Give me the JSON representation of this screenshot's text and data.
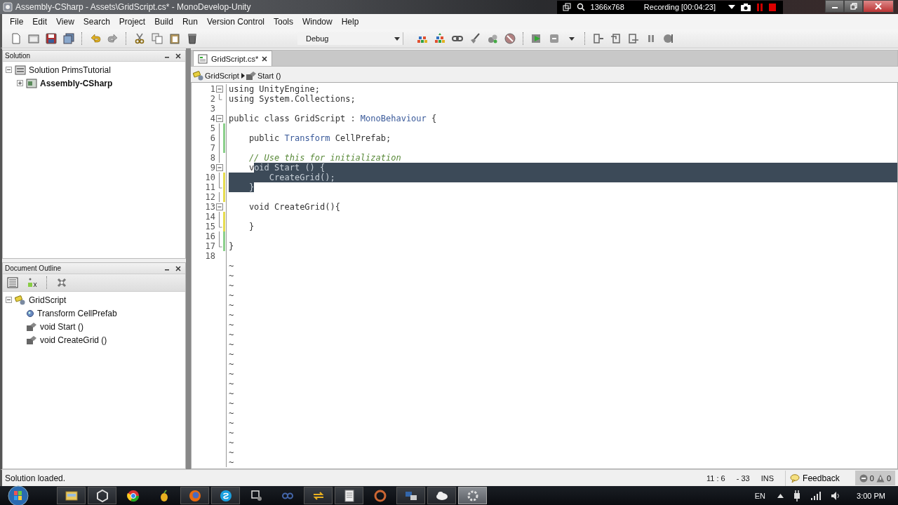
{
  "window": {
    "title": "Assembly-CSharp - Assets\\GridScript.cs* - MonoDevelop-Unity"
  },
  "recorder": {
    "resolution": "1366x768",
    "status": "Recording [00:04:23]"
  },
  "menu": [
    "File",
    "Edit",
    "View",
    "Search",
    "Project",
    "Build",
    "Run",
    "Version Control",
    "Tools",
    "Window",
    "Help"
  ],
  "toolbar": {
    "configuration": "Debug"
  },
  "solution_pane": {
    "title": "Solution",
    "tree": [
      {
        "label": "Solution PrimsTutorial",
        "kind": "solution",
        "expanded": true,
        "children": [
          {
            "label": "Assembly-CSharp",
            "kind": "project",
            "expanded": false
          }
        ]
      }
    ]
  },
  "outline_pane": {
    "title": "Document Outline",
    "tree": [
      {
        "label": "GridScript",
        "kind": "class",
        "expanded": true,
        "children": [
          {
            "label": "Transform CellPrefab",
            "kind": "field"
          },
          {
            "label": "void Start ()",
            "kind": "method"
          },
          {
            "label": "void CreateGrid ()",
            "kind": "method"
          }
        ]
      }
    ]
  },
  "editor": {
    "tabs": [
      {
        "label": "GridScript.cs*",
        "selected": true
      }
    ],
    "breadcrumb": [
      "GridScript",
      "Start ()"
    ],
    "lines": [
      {
        "number": "1",
        "fold_start": true,
        "tokens": [
          {
            "text": "using",
            "kind": "kw"
          },
          {
            "text": " UnityEngine;",
            "kind": "plain"
          }
        ]
      },
      {
        "number": "2",
        "fold_end": true,
        "tokens": [
          {
            "text": "using",
            "kind": "kw"
          },
          {
            "text": " System.Collections;",
            "kind": "plain"
          }
        ]
      },
      {
        "number": "3"
      },
      {
        "number": "4",
        "fold_start": true,
        "tokens": [
          {
            "text": "public class",
            "kind": "kw"
          },
          {
            "text": " GridScript : ",
            "kind": "plain"
          },
          {
            "text": "MonoBehaviour",
            "kind": "type"
          },
          {
            "text": " {",
            "kind": "plain"
          }
        ]
      },
      {
        "number": "5",
        "in_fold": true,
        "changed": true,
        "saved": true
      },
      {
        "number": "6",
        "in_fold": true,
        "changed": true,
        "saved": true,
        "tokens": [
          {
            "text": "    public ",
            "kind": "kw"
          },
          {
            "text": "Transform",
            "kind": "type"
          },
          {
            "text": " CellPrefab;",
            "kind": "plain"
          }
        ]
      },
      {
        "number": "7",
        "in_fold": true,
        "changed": true,
        "saved": true
      },
      {
        "number": "8",
        "in_fold": true,
        "tokens": [
          {
            "text": "    // Use this for initialization",
            "kind": "comment"
          }
        ]
      },
      {
        "number": "9",
        "fold_start": true,
        "selection_extends": true,
        "tokens": [
          {
            "text": "    v",
            "kind": "kw"
          },
          {
            "text": "oid",
            "kind": "kw",
            "selected": true
          },
          {
            "text": " Start () {",
            "kind": "plain",
            "selected": true
          }
        ]
      },
      {
        "number": "10",
        "in_fold": true,
        "changed": true,
        "saved": false,
        "selection_extends": true,
        "tokens": [
          {
            "text": "        CreateGrid();",
            "kind": "plain",
            "selected": true
          }
        ]
      },
      {
        "number": "11",
        "fold_end": true,
        "changed": true,
        "saved": false,
        "tokens": [
          {
            "text": "    }",
            "kind": "plain",
            "selected": true
          }
        ]
      },
      {
        "number": "12",
        "in_fold": true,
        "changed": true,
        "saved": false
      },
      {
        "number": "13",
        "fold_start": true,
        "tokens": [
          {
            "text": "    void",
            "kind": "kw"
          },
          {
            "text": " CreateGrid(){",
            "kind": "plain"
          }
        ]
      },
      {
        "number": "14",
        "in_fold": true,
        "changed": true,
        "saved": false
      },
      {
        "number": "15",
        "fold_end": true,
        "changed": true,
        "saved": false,
        "tokens": [
          {
            "text": "    }",
            "kind": "plain"
          }
        ]
      },
      {
        "number": "16",
        "in_fold": true,
        "changed": true,
        "saved": true
      },
      {
        "number": "17",
        "fold_end": true,
        "changed": true,
        "saved": true,
        "tokens": [
          {
            "text": "}",
            "kind": "plain"
          }
        ]
      },
      {
        "number": "18"
      }
    ],
    "empty_line_markers": [
      "~",
      "~",
      "~",
      "~",
      "~",
      "~",
      "~",
      "~",
      "~",
      "~",
      "~",
      "~",
      "~",
      "~",
      "~",
      "~",
      "~",
      "~",
      "~",
      "~",
      "~"
    ]
  },
  "status_bar": {
    "message": "Solution loaded.",
    "position": "11 : 6",
    "selection": "- 33",
    "mode": "INS",
    "feedback": "Feedback",
    "errors": "0",
    "warnings": "0"
  },
  "taskbar": {
    "apps": [
      {
        "running": true,
        "active": false
      },
      {
        "running": true,
        "active": false
      },
      {
        "running": false,
        "active": false
      },
      {
        "running": false,
        "active": false
      },
      {
        "running": true,
        "active": false
      },
      {
        "running": true,
        "active": false
      },
      {
        "running": false,
        "active": false
      },
      {
        "running": false,
        "active": false
      },
      {
        "running": true,
        "active": false
      },
      {
        "running": true,
        "active": false
      },
      {
        "running": false,
        "active": false
      },
      {
        "running": true,
        "active": false
      },
      {
        "running": true,
        "active": false
      },
      {
        "running": true,
        "active": true
      }
    ],
    "language": "EN",
    "clock": "3:00 PM"
  }
}
